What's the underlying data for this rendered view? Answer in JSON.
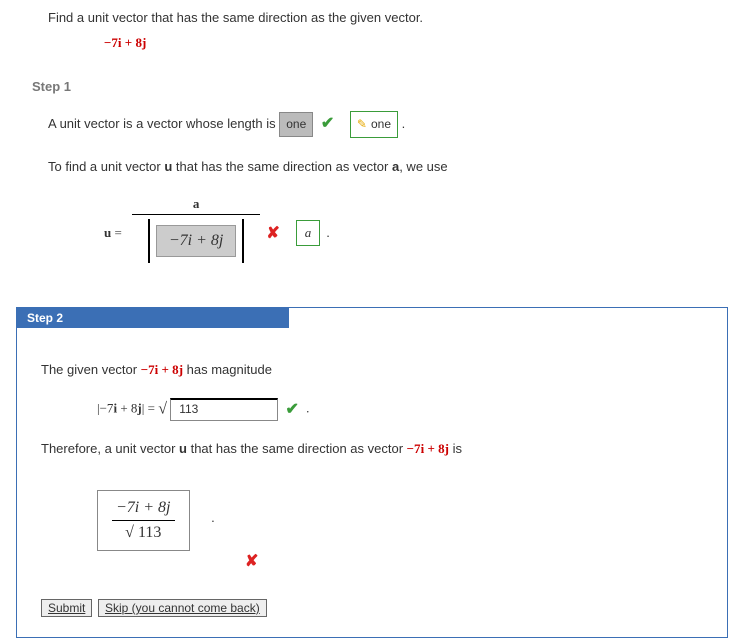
{
  "question": {
    "prompt": "Find a unit vector that has the same direction as the given vector.",
    "vector": "−7i + 8j"
  },
  "step1": {
    "header": "Step 1",
    "line1_pre": "A unit vector is a vector whose length is ",
    "answer1": "one",
    "hint1": "one",
    "line2_pre": "To find a unit vector ",
    "u": "u",
    "line2_mid": " that has the same direction as vector ",
    "a": "a",
    "line2_post": ", we use",
    "eq_label": "u =",
    "numerator": "a",
    "denom_answer": "−7i + 8j",
    "denom_hint": "a"
  },
  "step2": {
    "tab": "Step 2",
    "line1_pre": "The given vector ",
    "vector": "−7i + 8j",
    "line1_post": "  has magnitude",
    "mag_lhs": "|−7i + 8j| = ",
    "sqrt": "√",
    "mag_input": "113",
    "dot": ".",
    "line2_pre": "Therefore, a unit vector ",
    "u": "u",
    "line2_mid": " that has the same direction as vector ",
    "vector2": "−7i + 8j",
    "line2_post": "  is",
    "final_num": "−7i + 8j",
    "final_den_sqrt": "√",
    "final_den_val": "113",
    "submit": "Submit",
    "skip": "Skip (you cannot come back)"
  }
}
